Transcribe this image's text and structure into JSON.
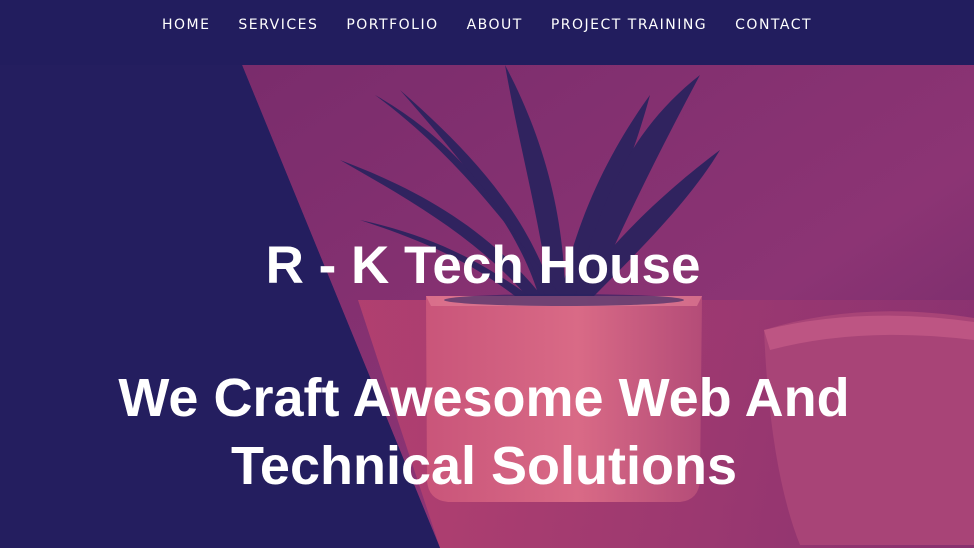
{
  "nav": {
    "items": [
      {
        "label": "HOME"
      },
      {
        "label": "SERVICES"
      },
      {
        "label": "PORTFOLIO"
      },
      {
        "label": "ABOUT"
      },
      {
        "label": "PROJECT TRAINING"
      },
      {
        "label": "CONTACT"
      }
    ]
  },
  "hero": {
    "title": "R - K Tech House",
    "tagline": "We Craft Awesome Web And Technical Solutions",
    "background_image": "potted-plant-with-cup-photo",
    "overlay_colors": {
      "dark": "#221d5e",
      "magenta": "#8e3373"
    }
  }
}
